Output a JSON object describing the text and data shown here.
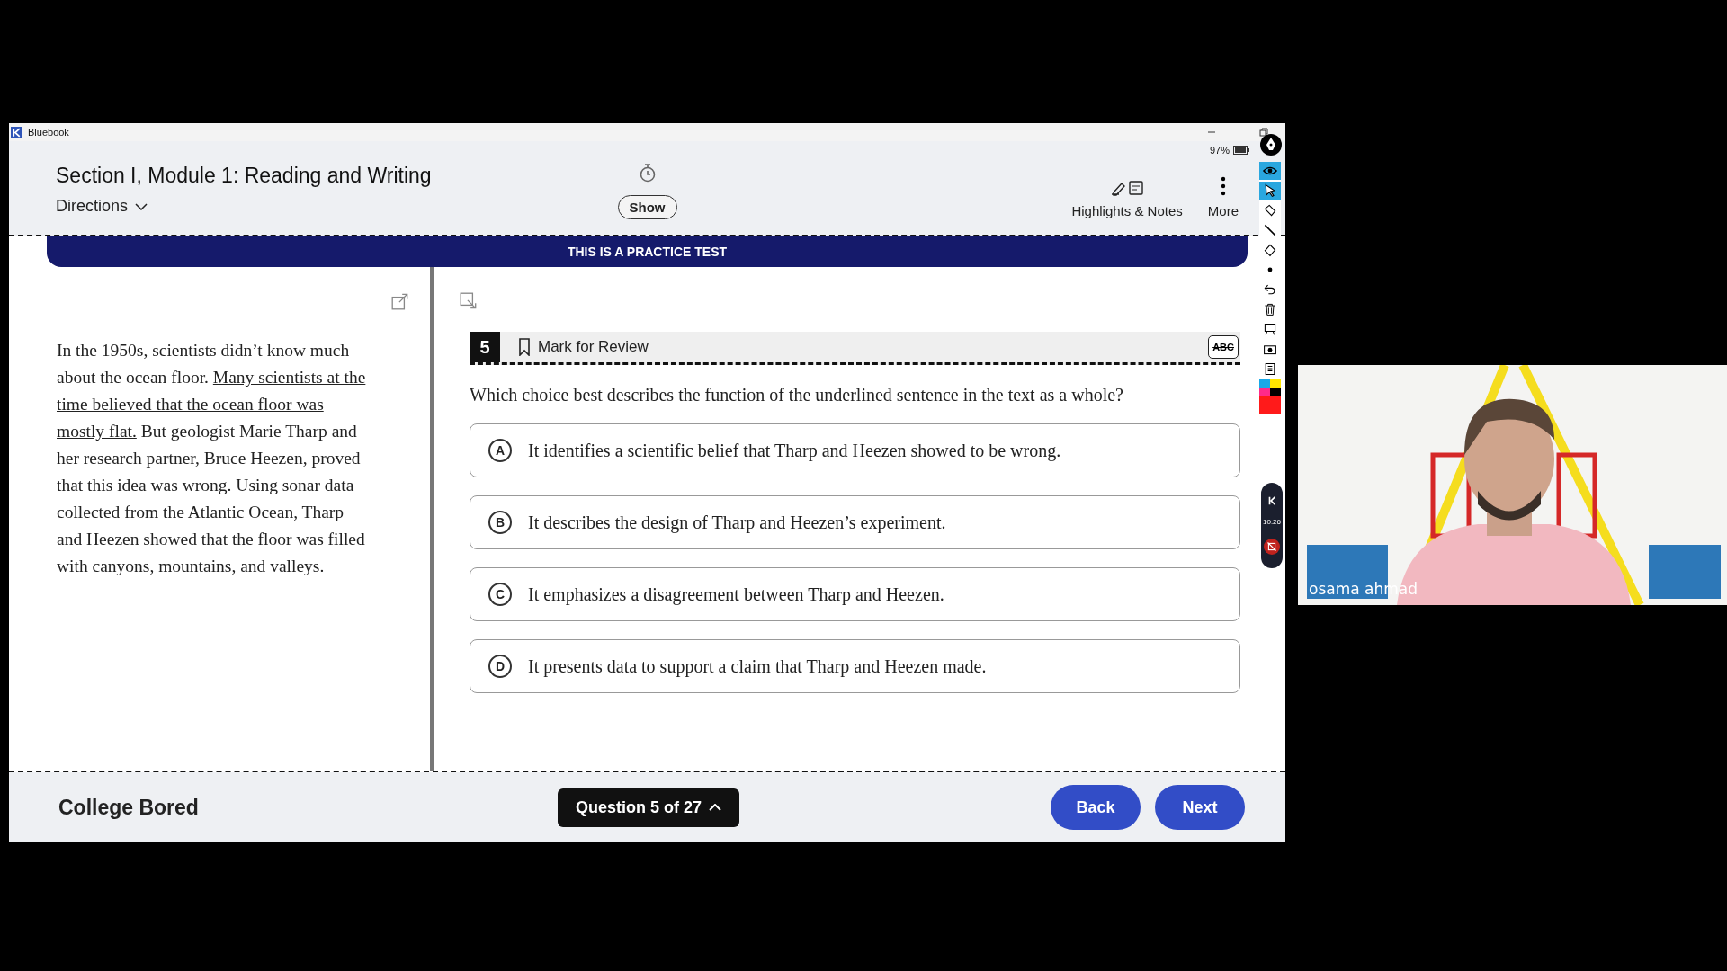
{
  "window": {
    "title": "Bluebook"
  },
  "header": {
    "title": "Section I, Module 1: Reading and Writing",
    "directions": "Directions",
    "timer_button": "Show",
    "highlights": "Highlights & Notes",
    "more": "More",
    "battery": "97%"
  },
  "banner": "THIS IS A PRACTICE TEST",
  "passage": [
    {
      "text": "In the 1950s, scientists didn’t know much about the ocean floor. ",
      "underlined": false
    },
    {
      "text": "Many scientists at the time believed that the ocean floor was mostly flat.",
      "underlined": true
    },
    {
      "text": " But geologist Marie Tharp and her research partner, Bruce Heezen, proved that this idea was wrong. Using sonar data collected from the Atlantic Ocean, Tharp and Heezen showed that the floor was filled with canyons, mountains, and valleys.",
      "underlined": false
    }
  ],
  "question": {
    "number": "5",
    "mark_for_review": "Mark for Review",
    "marked": false,
    "eliminator": "ABC",
    "prompt": "Which choice best describes the function of the underlined sentence in the text as a whole?"
  },
  "choices": [
    {
      "letter": "A",
      "text": "It identifies a scientific belief that Tharp and Heezen showed to be wrong.",
      "selected": false
    },
    {
      "letter": "B",
      "text": "It describes the design of Tharp and Heezen’s experiment.",
      "selected": false
    },
    {
      "letter": "C",
      "text": "It emphasizes a disagreement between Tharp and Heezen.",
      "selected": false
    },
    {
      "letter": "D",
      "text": "It presents data to support a claim that Tharp and Heezen made.",
      "selected": false
    }
  ],
  "footer": {
    "name": "College Bored",
    "navigator": "Question 5 of 27",
    "back": "Back",
    "next": "Next"
  },
  "annotation_toolbar": {
    "tools": [
      {
        "kind": "eye",
        "selected": true
      },
      {
        "kind": "pointer",
        "selected": true
      },
      {
        "kind": "pen",
        "selected": false
      },
      {
        "kind": "line",
        "selected": false
      },
      {
        "kind": "eraser",
        "selected": false
      },
      {
        "kind": "dot",
        "selected": false
      },
      {
        "kind": "undo",
        "selected": false
      },
      {
        "kind": "trash",
        "selected": false
      },
      {
        "kind": "board",
        "selected": false
      },
      {
        "kind": "camera",
        "selected": false
      },
      {
        "kind": "clipboard",
        "selected": false
      }
    ],
    "recorder_time": "10:26"
  },
  "webcam": {
    "participant": "osama ahmad"
  }
}
